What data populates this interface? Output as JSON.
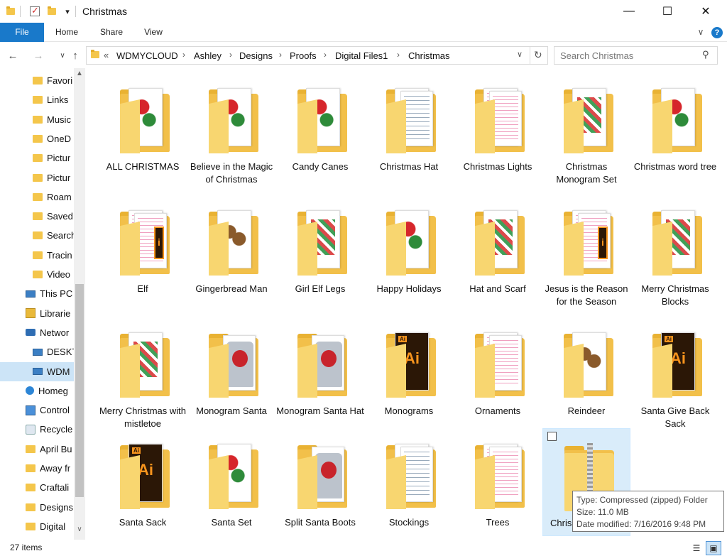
{
  "window": {
    "title": "Christmas",
    "minimize": "—",
    "maximize": "☐",
    "close": "✕"
  },
  "ribbon": {
    "tabs": [
      "File",
      "Home",
      "Share",
      "View"
    ],
    "expand_icon": "chevron-down-icon",
    "help_icon": "help-icon"
  },
  "address": {
    "prefix": "«",
    "crumbs": [
      "WDMYCLOUD",
      "Ashley",
      "Designs",
      "Proofs",
      "Digital Files1",
      "Christmas"
    ],
    "separator": "›"
  },
  "search": {
    "placeholder": "Search Christmas"
  },
  "navpane": {
    "items": [
      {
        "label": "Favori",
        "icon": "folder"
      },
      {
        "label": "Links",
        "icon": "folder"
      },
      {
        "label": "Music",
        "icon": "folder"
      },
      {
        "label": "OneD",
        "icon": "folder"
      },
      {
        "label": "Pictur",
        "icon": "folder"
      },
      {
        "label": "Pictur",
        "icon": "folder"
      },
      {
        "label": "Roam",
        "icon": "folder"
      },
      {
        "label": "Saved",
        "icon": "folder"
      },
      {
        "label": "Search",
        "icon": "folder"
      },
      {
        "label": "Tracin",
        "icon": "folder"
      },
      {
        "label": "Video",
        "icon": "folder"
      },
      {
        "label": "This PC",
        "icon": "pc"
      },
      {
        "label": "Librarie",
        "icon": "lib"
      },
      {
        "label": "Networ",
        "icon": "net"
      },
      {
        "label": "DESKT",
        "icon": "pc"
      },
      {
        "label": "WDM",
        "icon": "pc"
      },
      {
        "label": "Homeg",
        "icon": "home"
      },
      {
        "label": "Control",
        "icon": "cp"
      },
      {
        "label": "Recycle",
        "icon": "bin"
      },
      {
        "label": "April Bu",
        "icon": "folder"
      },
      {
        "label": "Away fr",
        "icon": "folder"
      },
      {
        "label": "Craftali",
        "icon": "folder"
      },
      {
        "label": "Designs",
        "icon": "folder"
      },
      {
        "label": "Digital",
        "icon": "folder"
      }
    ],
    "selected_index": 15
  },
  "files": [
    {
      "name": "ALL CHRISTMAS",
      "art": "red"
    },
    {
      "name": "Believe in the Magic of Christmas",
      "art": "red"
    },
    {
      "name": "Candy Canes",
      "art": "red"
    },
    {
      "name": "Christmas Hat",
      "art": "blank"
    },
    {
      "name": "Christmas Lights",
      "art": "pink"
    },
    {
      "name": "Christmas Monogram Set",
      "art": "green"
    },
    {
      "name": "Christmas word tree",
      "art": "red"
    },
    {
      "name": "Elf",
      "art": "pink-ai"
    },
    {
      "name": "Gingerbread Man",
      "art": "brown"
    },
    {
      "name": "Girl Elf Legs",
      "art": "green"
    },
    {
      "name": "Happy Holidays",
      "art": "red"
    },
    {
      "name": "Hat and Scarf",
      "art": "green"
    },
    {
      "name": "Jesus is the Reason for the Season",
      "art": "pink-ai"
    },
    {
      "name": "Merry Christmas Blocks",
      "art": "green"
    },
    {
      "name": "Merry Christmas with mistletoe",
      "art": "green"
    },
    {
      "name": "Monogram Santa",
      "art": "shirt"
    },
    {
      "name": "Monogram Santa Hat",
      "art": "shirt"
    },
    {
      "name": "Monograms",
      "art": "ai"
    },
    {
      "name": "Ornaments",
      "art": "pink"
    },
    {
      "name": "Reindeer",
      "art": "brown"
    },
    {
      "name": "Santa Give Back Sack",
      "art": "ai"
    },
    {
      "name": "Santa Sack",
      "art": "ai"
    },
    {
      "name": "Santa Set",
      "art": "red"
    },
    {
      "name": "Split Santa Boots",
      "art": "shirt"
    },
    {
      "name": "Stockings",
      "art": "blank"
    },
    {
      "name": "Trees",
      "art": "pink"
    },
    {
      "name": "Chris",
      "art": "zip",
      "selected": true
    }
  ],
  "tooltip": {
    "type": "Type: Compressed (zipped) Folder",
    "size": "Size: 11.0 MB",
    "date": "Date modified: 7/16/2016 9:48 PM"
  },
  "status": {
    "count": "27 items"
  }
}
